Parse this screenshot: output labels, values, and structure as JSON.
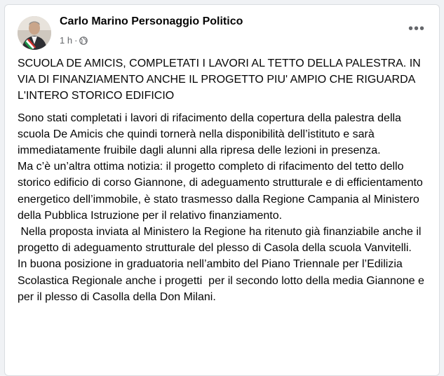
{
  "post": {
    "author": "Carlo Marino Personaggio Politico",
    "time": "1 h",
    "separator": "·",
    "more_label": "•••",
    "icons": {
      "avatar": "profile-photo",
      "privacy": "globe-icon",
      "more": "more-options-icon"
    },
    "headline": "SCUOLA DE AMICIS, COMPLETATI I LAVORI AL TETTO DELLA PALESTRA. IN VIA DI FINANZIAMENTO ANCHE IL PROGETTO PIU' AMPIO CHE RIGUARDA L'INTERO STORICO EDIFICIO",
    "body": [
      "Sono stati completati i lavori di rifacimento della copertura della palestra della scuola De Amicis che quindi tornerà nella disponibilità dell’istituto e sarà immediatamente fruibile dagli alunni alla ripresa delle lezioni in presenza.",
      "Ma c’è un’altra ottima notizia: il progetto completo di rifacimento del tetto dello storico edificio di corso Giannone, di adeguamento strutturale e di efficientamento energetico dell’immobile, è stato trasmesso dalla Regione Campania al Ministero della Pubblica Istruzione per il relativo finanziamento.",
      " Nella proposta inviata al Ministero la Regione ha ritenuto già finanziabile anche il progetto di adeguamento strutturale del plesso di Casola della scuola Vanvitelli.",
      "In buona posizione in graduatoria nell’ambito del Piano Triennale per l’Edilizia Scolastica Regionale anche i progetti  per il secondo lotto della media Giannone e per il plesso di Casolla della Don Milani."
    ]
  }
}
